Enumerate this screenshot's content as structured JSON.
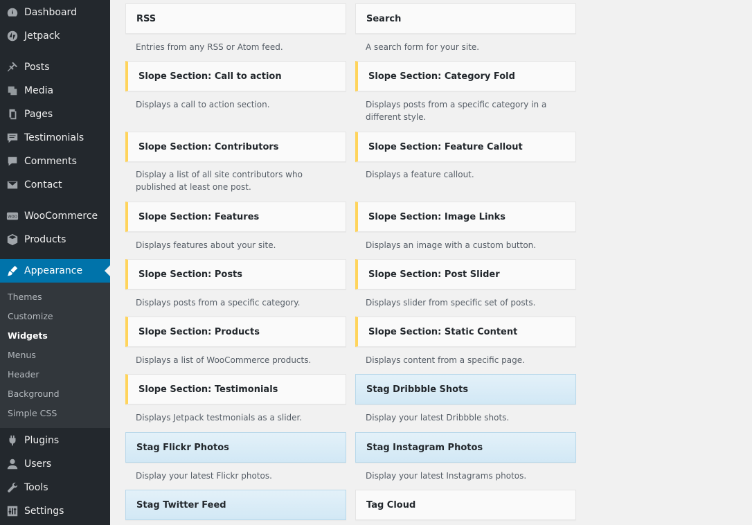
{
  "sidebar": {
    "items": [
      {
        "label": "Dashboard",
        "icon": "dashboard-icon"
      },
      {
        "label": "Jetpack",
        "icon": "jetpack-icon"
      },
      {
        "label": "Posts",
        "icon": "pushpin-icon"
      },
      {
        "label": "Media",
        "icon": "media-icon"
      },
      {
        "label": "Pages",
        "icon": "pages-icon"
      },
      {
        "label": "Testimonials",
        "icon": "testimonials-icon"
      },
      {
        "label": "Comments",
        "icon": "comments-icon"
      },
      {
        "label": "Contact",
        "icon": "envelope-icon"
      },
      {
        "label": "WooCommerce",
        "icon": "woocommerce-icon"
      },
      {
        "label": "Products",
        "icon": "products-box-icon"
      },
      {
        "label": "Appearance",
        "icon": "paintbrush-icon"
      },
      {
        "label": "Plugins",
        "icon": "plugin-icon"
      },
      {
        "label": "Users",
        "icon": "users-icon"
      },
      {
        "label": "Tools",
        "icon": "wrench-icon"
      },
      {
        "label": "Settings",
        "icon": "settings-sliders-icon"
      }
    ],
    "submenu": [
      "Themes",
      "Customize",
      "Widgets",
      "Menus",
      "Header",
      "Background",
      "Simple CSS"
    ]
  },
  "widgets": [
    {
      "title": "RSS",
      "desc": "Entries from any RSS or Atom feed."
    },
    {
      "title": "Search",
      "desc": "A search form for your site."
    },
    {
      "title": "Slope Section: Call to action",
      "desc": "Displays a call to action section."
    },
    {
      "title": "Slope Section: Category Fold",
      "desc": "Displays posts from a specific category in a different style."
    },
    {
      "title": "Slope Section: Contributors",
      "desc": "Display a list of all site contributors who published at least one post."
    },
    {
      "title": "Slope Section: Feature Callout",
      "desc": "Displays a feature callout."
    },
    {
      "title": "Slope Section: Features",
      "desc": "Displays features about your site."
    },
    {
      "title": "Slope Section: Image Links",
      "desc": "Displays an image with a custom button."
    },
    {
      "title": "Slope Section: Posts",
      "desc": "Displays posts from a specific category."
    },
    {
      "title": "Slope Section: Post Slider",
      "desc": "Displays slider from specific set of posts."
    },
    {
      "title": "Slope Section: Products",
      "desc": "Displays a list of WooCommerce products."
    },
    {
      "title": "Slope Section: Static Content",
      "desc": "Displays content from a specific page."
    },
    {
      "title": "Slope Section: Testimonials",
      "desc": "Displays Jetpack testmonials as a slider."
    },
    {
      "title": "Stag Dribbble Shots",
      "desc": "Display your latest Dribbble shots."
    },
    {
      "title": "Stag Flickr Photos",
      "desc": "Display your latest Flickr photos."
    },
    {
      "title": "Stag Instagram Photos",
      "desc": "Display your latest Instagrams photos."
    },
    {
      "title": "Stag Twitter Feed",
      "desc": ""
    },
    {
      "title": "Tag Cloud",
      "desc": ""
    }
  ],
  "colors": {
    "sidebar_bg": "#23282d",
    "submenu_bg": "#32373c",
    "current": "#0073aa",
    "slope_accent": "#ffd45c",
    "stag_bg": "#d2e8f5"
  }
}
